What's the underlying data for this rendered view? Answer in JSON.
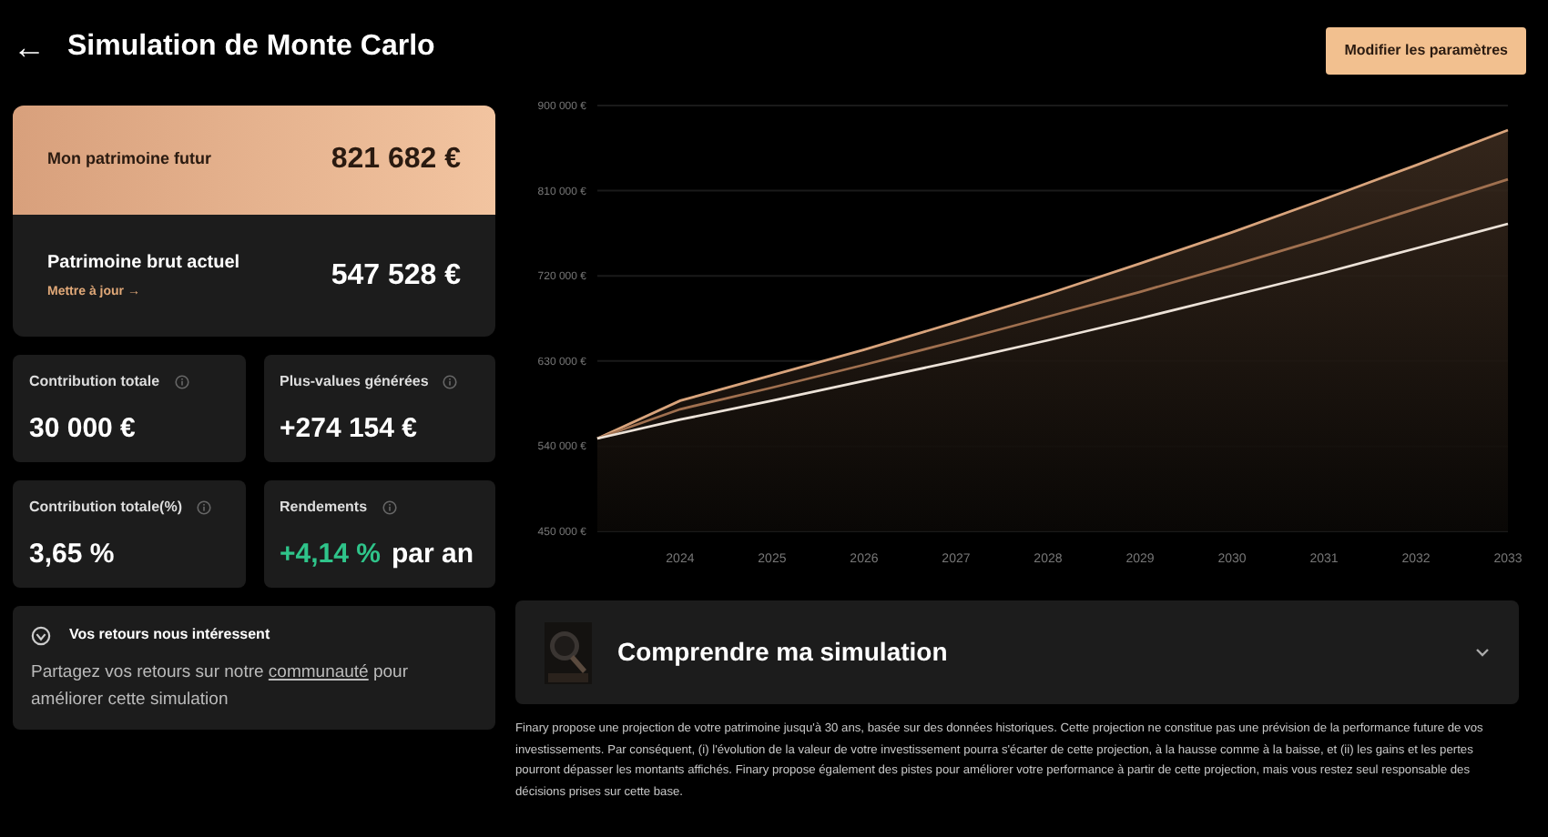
{
  "header": {
    "back": "←",
    "title": "Simulation de Monte Carlo",
    "button": "Modifier les paramètres"
  },
  "wealth_card": {
    "future_label": "Mon patrimoine futur",
    "future_value": "821 682 €",
    "current_label": "Patrimoine brut actuel",
    "update_link": "Mettre à jour →",
    "current_value": "547 528 €"
  },
  "stats": [
    {
      "label": "Contribution totale",
      "value": "30 000 €",
      "highlight": false
    },
    {
      "label": "Plus-values générées",
      "value": "+274 154 €",
      "highlight": false
    },
    {
      "label": "Contribution totale(%)",
      "value": "3,65 %",
      "highlight": false
    },
    {
      "label": "Rendements",
      "value": "+4,14 %",
      "suffix": "par an",
      "highlight": true
    }
  ],
  "feedback": {
    "title": "Vos retours nous intéressent",
    "text_before": "Partagez vos retours sur notre",
    "link": "communauté",
    "text_after": "pour améliorer cette simulation"
  },
  "chart_data": {
    "type": "area",
    "grid": true,
    "x": [
      2023.1,
      2024,
      2025,
      2026,
      2027,
      2028,
      2029,
      2030,
      2031,
      2032,
      2033
    ],
    "series": [
      {
        "color": "#d9a47c",
        "values": [
          548000,
          588000,
          615000,
          642000,
          671000,
          701000,
          733000,
          766000,
          801000,
          837000,
          874000
        ]
      },
      {
        "type": "line",
        "color": "#a0704f",
        "values": [
          548000,
          579000,
          602000,
          626000,
          651000,
          677000,
          703000,
          731000,
          760000,
          791000,
          822000
        ]
      },
      {
        "type": "line",
        "color": "#ece2d8",
        "values": [
          548000,
          568000,
          588000,
          609000,
          630000,
          652000,
          675000,
          699000,
          723000,
          749000,
          775000
        ]
      }
    ],
    "xlim": [
      2023.1,
      2033
    ],
    "ylim": [
      450000,
      900000
    ],
    "xticks": [
      2024,
      2025,
      2026,
      2027,
      2028,
      2029,
      2030,
      2031,
      2032,
      2033
    ],
    "yticks": [
      {
        "value": 450000,
        "label": "450 000 €"
      },
      {
        "value": 540000,
        "label": "540 000 €"
      },
      {
        "value": 630000,
        "label": "630 000 €"
      },
      {
        "value": 720000,
        "label": "720 000 €"
      },
      {
        "value": 810000,
        "label": "810 000 €"
      },
      {
        "value": 900000,
        "label": "900 000 €"
      }
    ]
  },
  "accordion": {
    "title": "Comprendre ma simulation",
    "expanded": false
  },
  "disclaimer": "Finary propose une projection de votre patrimoine jusqu'à 30 ans, basée sur des données historiques. Cette projection ne constitue pas une prévision de la performance future de vos investissements. Par conséquent, (i) l'évolution de la valeur de votre investissement pourra s'écarter de cette projection, à la hausse comme à la baisse, et (ii) les gains et les pertes pourront dépasser les montants affichés. Finary propose également des pistes pour améliorer votre performance à partir de cette projection, mais vous restez seul responsable des décisions prises sur cette base."
}
